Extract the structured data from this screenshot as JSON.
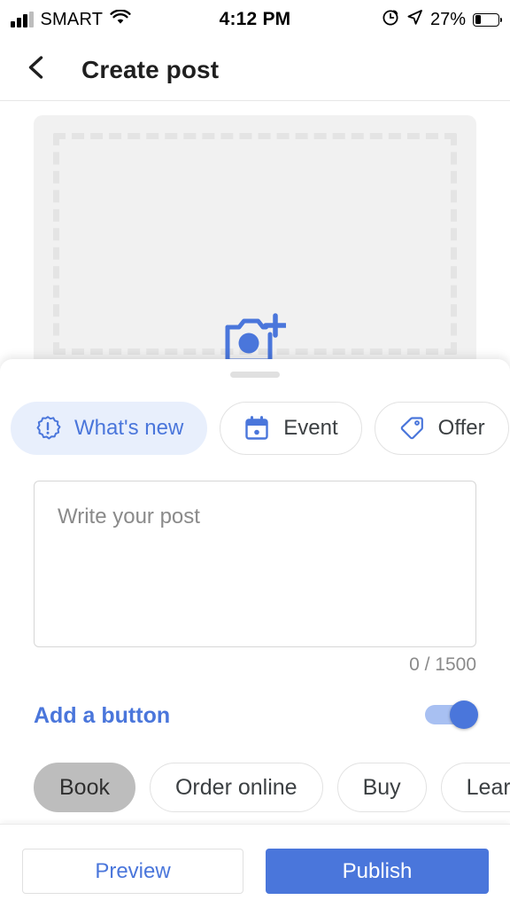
{
  "status_bar": {
    "carrier": "SMART",
    "time": "4:12 PM",
    "battery_percent": "27%",
    "icons": [
      "signal-bars-icon",
      "wifi-icon",
      "alarm-icon",
      "location-arrow-icon",
      "battery-icon"
    ]
  },
  "header": {
    "back_icon": "chevron-left-icon",
    "title": "Create post"
  },
  "media": {
    "add_photo_icon": "camera-plus-icon"
  },
  "post_types": [
    {
      "label": "What's new",
      "icon": "starburst-exclamation-icon",
      "selected": true
    },
    {
      "label": "Event",
      "icon": "calendar-icon",
      "selected": false
    },
    {
      "label": "Offer",
      "icon": "tag-icon",
      "selected": false
    }
  ],
  "post_text": {
    "value": "",
    "placeholder": "Write your post",
    "counter": "0 / 1500"
  },
  "add_button": {
    "label": "Add a button",
    "toggle_on": true
  },
  "action_types": [
    {
      "label": "Book",
      "selected": true
    },
    {
      "label": "Order online",
      "selected": false
    },
    {
      "label": "Buy",
      "selected": false
    },
    {
      "label": "Learn more",
      "selected": false
    }
  ],
  "footer": {
    "preview_label": "Preview",
    "publish_label": "Publish"
  },
  "colors": {
    "accent_blue": "#4a76db",
    "chip_selected_bg": "#e8effc",
    "action_selected_bg": "#bdbdbd",
    "media_bg": "#f1f1f1"
  }
}
